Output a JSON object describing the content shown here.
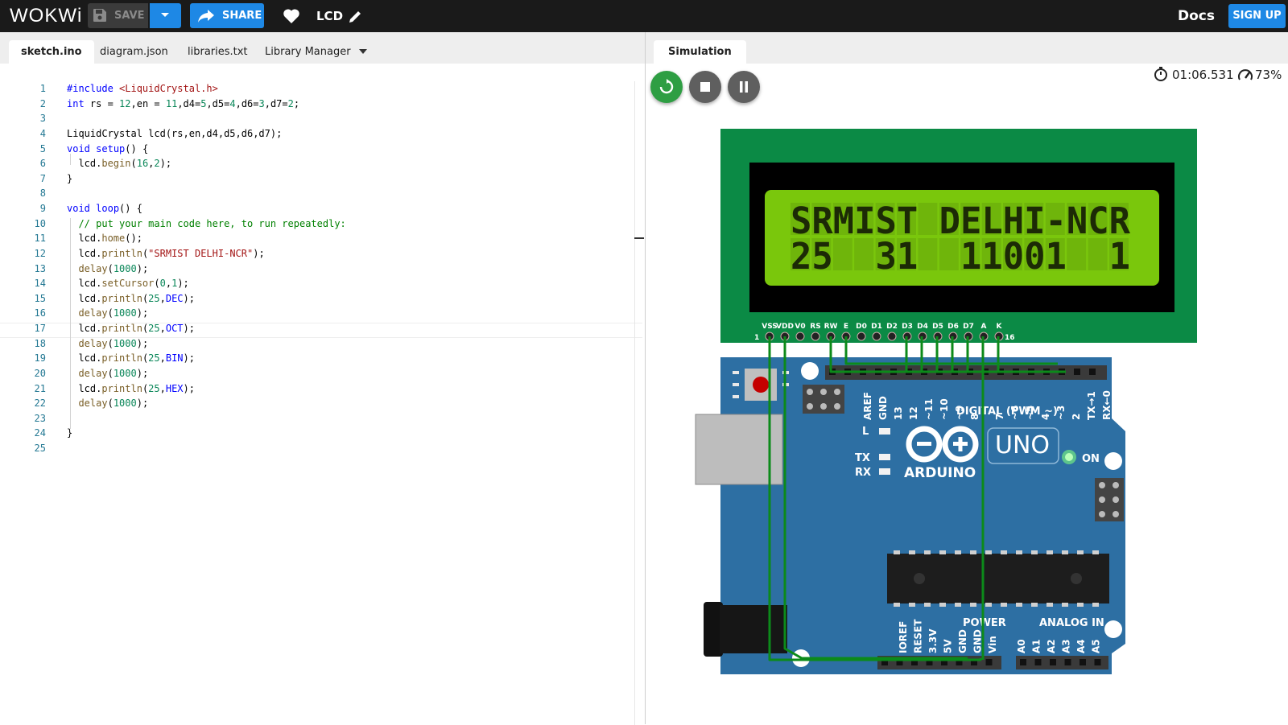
{
  "app": {
    "logo": "WOKWi",
    "project_name": "LCD"
  },
  "toolbar": {
    "save_label": "SAVE",
    "share_label": "SHARE",
    "docs_label": "Docs",
    "signup_label": "SIGN UP"
  },
  "editor": {
    "tabs": [
      "sketch.ino",
      "diagram.json",
      "libraries.txt",
      "Library Manager"
    ],
    "active_tab": "sketch.ino",
    "line_numbers": [
      "1",
      "2",
      "3",
      "4",
      "5",
      "6",
      "7",
      "8",
      "9",
      "10",
      "11",
      "12",
      "13",
      "14",
      "15",
      "16",
      "17",
      "18",
      "19",
      "20",
      "21",
      "22",
      "23",
      "24",
      "25"
    ],
    "lines": [
      "#include <LiquidCrystal.h>",
      "int rs = 12,en = 11,d4=5,d5=4,d6=3,d7=2;",
      "",
      "LiquidCrystal lcd(rs,en,d4,d5,d6,d7);",
      "void setup() {",
      "  lcd.begin(16,2);",
      "}",
      "",
      "void loop() {",
      "  // put your main code here, to run repeatedly:",
      "  lcd.home();",
      "  lcd.println(\"SRMIST DELHI-NCR\");",
      "  delay(1000);",
      "  lcd.setCursor(0,1);",
      "  lcd.println(25,DEC);",
      "  delay(1000);",
      "  lcd.println(25,OCT);",
      "  delay(1000);",
      "  lcd.println(25,BIN);",
      "  delay(1000);",
      "  lcd.println(25,HEX);",
      "  delay(1000);",
      "",
      "}",
      ""
    ],
    "current_line": 17
  },
  "simulation": {
    "tab_label": "Simulation",
    "elapsed": "01:06.531",
    "speed": "73%",
    "lcd": {
      "row1": "SRMIST DELHI-NCR",
      "row2": "25  31  11001  1",
      "pin_labels": [
        "VSS",
        "VDD",
        "V0",
        "RS",
        "RW",
        "E",
        "D0",
        "D1",
        "D2",
        "D3",
        "D4",
        "D5",
        "D6",
        "D7",
        "A",
        "K"
      ],
      "pin_first": "1",
      "pin_last": "16"
    },
    "arduino": {
      "brand": "ARDUINO",
      "model": "UNO",
      "on_label": "ON",
      "l_label": "L",
      "tx_label": "TX",
      "rx_label": "RX",
      "digital_label": "DIGITAL (PWM ~)",
      "digital_pins": [
        "AREF",
        "GND",
        "13",
        "12",
        "~11",
        "~10",
        "~9",
        "8",
        "7",
        "~6",
        "~5",
        "4",
        "~3",
        "2",
        "TX→1",
        "RX←0"
      ],
      "power_label": "POWER",
      "power_pins": [
        "IOREF",
        "RESET",
        "3.3V",
        "5V",
        "GND",
        "GND",
        "Vin"
      ],
      "analog_label": "ANALOG IN",
      "analog_pins": [
        "A0",
        "A1",
        "A2",
        "A3",
        "A4",
        "A5"
      ]
    },
    "colors": {
      "lcd_board": "#0b8a45",
      "lcd_screen": "#7ac70c",
      "arduino": "#2d6fa3",
      "wire": "#0c8a1a",
      "accent": "#1e88e5"
    }
  }
}
